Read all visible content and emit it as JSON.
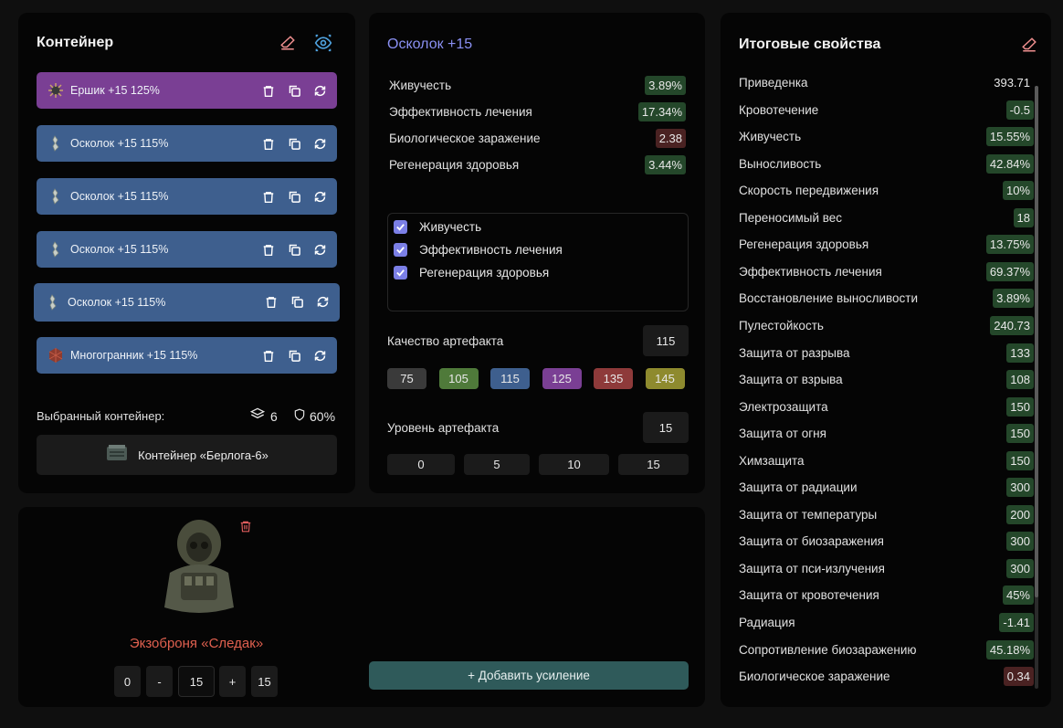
{
  "container": {
    "title": "Контейнер",
    "slots": [
      {
        "label": "Ершик +15 125%",
        "color": "purple",
        "art_icon": "spiky-artifact-icon"
      },
      {
        "label": "Осколок +15 115%",
        "color": "blue",
        "art_icon": "shard-artifact-icon"
      },
      {
        "label": "Осколок +15 115%",
        "color": "blue",
        "art_icon": "shard-artifact-icon"
      },
      {
        "label": "Осколок +15 115%",
        "color": "blue",
        "art_icon": "shard-artifact-icon"
      },
      {
        "label": "Осколок +15 115%",
        "color": "blue",
        "art_icon": "shard-artifact-icon"
      },
      {
        "label": "Многогранник +15 115%",
        "color": "blue",
        "art_icon": "polyhedron-artifact-icon"
      }
    ],
    "selected_label": "Выбранный контейнер:",
    "slots_count": "6",
    "protection": "60%",
    "container_name": "Контейнер «Берлога-6»"
  },
  "artifact": {
    "title": "Осколок +15",
    "stats": [
      {
        "name": "Живучесть",
        "value": "3.89%",
        "kind": "pos"
      },
      {
        "name": "Эффективность лечения",
        "value": "17.34%",
        "kind": "pos"
      },
      {
        "name": "Биологическое заражение",
        "value": "2.38",
        "kind": "neg"
      },
      {
        "name": "Регенерация здоровья",
        "value": "3.44%",
        "kind": "pos"
      }
    ],
    "checks": [
      "Живучесть",
      "Эффективность лечения",
      "Регенерация здоровья"
    ],
    "quality_label": "Качество артефакта",
    "quality_value": "115",
    "quality_options": [
      {
        "label": "75",
        "color": "#3a3a3a"
      },
      {
        "label": "105",
        "color": "#4f7a3a"
      },
      {
        "label": "115",
        "color": "#3e5f8e"
      },
      {
        "label": "125",
        "color": "#7a3f94"
      },
      {
        "label": "135",
        "color": "#8e3a3a"
      },
      {
        "label": "145",
        "color": "#8e8a2e"
      }
    ],
    "level_label": "Уровень артефакта",
    "level_value": "15",
    "level_options": [
      "0",
      "5",
      "10",
      "15"
    ]
  },
  "totals": {
    "title": "Итоговые свойства",
    "rows": [
      {
        "name": "Приведенка",
        "value": "393.71",
        "kind": "plain"
      },
      {
        "name": "Кровотечение",
        "value": "-0.5",
        "kind": "pos"
      },
      {
        "name": "Живучесть",
        "value": "15.55%",
        "kind": "pos"
      },
      {
        "name": "Выносливость",
        "value": "42.84%",
        "kind": "pos"
      },
      {
        "name": "Скорость передвижения",
        "value": "10%",
        "kind": "pos"
      },
      {
        "name": "Переносимый вес",
        "value": "18",
        "kind": "pos"
      },
      {
        "name": "Регенерация здоровья",
        "value": "13.75%",
        "kind": "pos"
      },
      {
        "name": "Эффективность лечения",
        "value": "69.37%",
        "kind": "pos"
      },
      {
        "name": "Восстановление выносливости",
        "value": "3.89%",
        "kind": "pos"
      },
      {
        "name": "Пулестойкость",
        "value": "240.73",
        "kind": "pos"
      },
      {
        "name": "Защита от разрыва",
        "value": "133",
        "kind": "pos"
      },
      {
        "name": "Защита от взрыва",
        "value": "108",
        "kind": "pos"
      },
      {
        "name": "Электрозащита",
        "value": "150",
        "kind": "pos"
      },
      {
        "name": "Защита от огня",
        "value": "150",
        "kind": "pos"
      },
      {
        "name": "Химзащита",
        "value": "150",
        "kind": "pos"
      },
      {
        "name": "Защита от радиации",
        "value": "300",
        "kind": "pos"
      },
      {
        "name": "Защита от температуры",
        "value": "200",
        "kind": "pos"
      },
      {
        "name": "Защита от биозаражения",
        "value": "300",
        "kind": "pos"
      },
      {
        "name": "Защита от пси-излучения",
        "value": "300",
        "kind": "pos"
      },
      {
        "name": "Защита от кровотечения",
        "value": "45%",
        "kind": "pos"
      },
      {
        "name": "Радиация",
        "value": "-1.41",
        "kind": "pos"
      },
      {
        "name": "Сопротивление биозаражению",
        "value": "45.18%",
        "kind": "pos"
      },
      {
        "name": "Биологическое заражение",
        "value": "0.34",
        "kind": "neg"
      }
    ]
  },
  "armor": {
    "name": "Экзоброня «Следак»",
    "name_color": "#e0604f",
    "level_min": "0",
    "minus": "-",
    "level_current": "15",
    "plus": "+",
    "level_max": "15",
    "add_button": "+ Добавить усиление"
  }
}
